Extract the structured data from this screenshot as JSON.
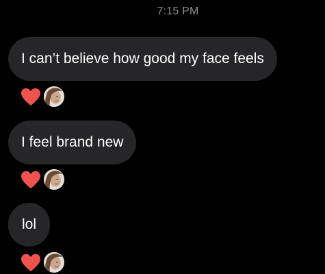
{
  "conversation": {
    "timestamp": "7:15 PM",
    "messages": [
      {
        "text": "I can’t believe how good my face feels",
        "reaction": "heart-icon"
      },
      {
        "text": "I feel brand new",
        "reaction": "heart-icon"
      },
      {
        "text": "lol",
        "reaction": "heart-icon"
      }
    ]
  },
  "colors": {
    "background": "#000000",
    "bubble": "#262628",
    "timestamp": "#8e8e93",
    "heart": "#ef5350"
  }
}
